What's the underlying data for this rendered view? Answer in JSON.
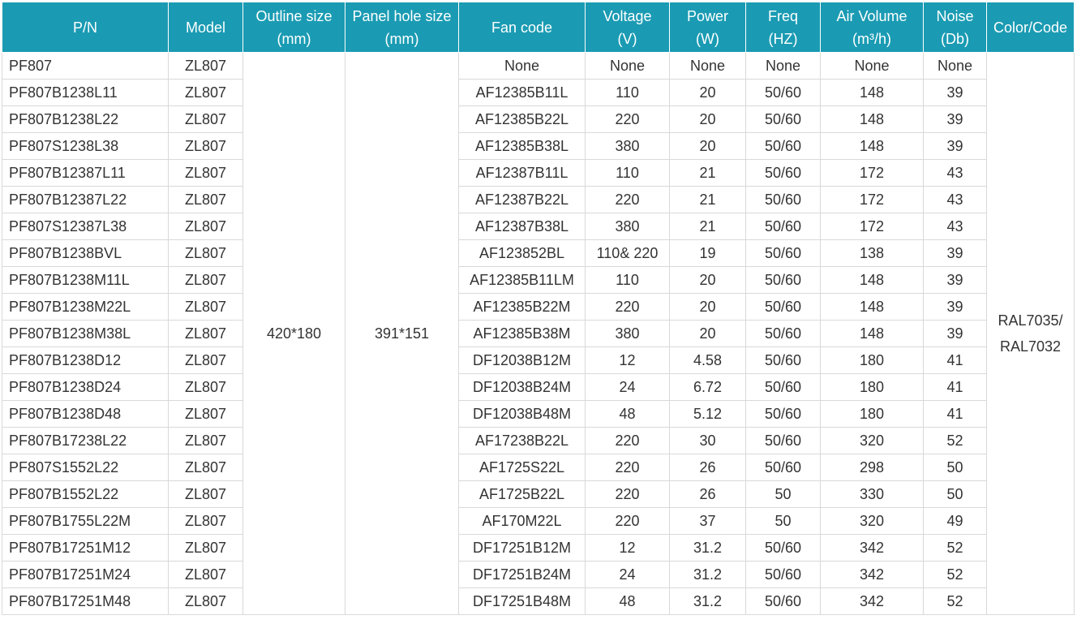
{
  "headers": [
    {
      "line1": "P/N",
      "line2": ""
    },
    {
      "line1": "Model",
      "line2": ""
    },
    {
      "line1": "Outline size",
      "line2": "(mm)"
    },
    {
      "line1": "Panel hole size",
      "line2": "(mm)"
    },
    {
      "line1": "Fan code",
      "line2": ""
    },
    {
      "line1": "Voltage",
      "line2": "(V)"
    },
    {
      "line1": "Power",
      "line2": "(W)"
    },
    {
      "line1": "Freq",
      "line2": "(HZ)"
    },
    {
      "line1": "Air Volume",
      "line2": "(m³/h)"
    },
    {
      "line1": "Noise",
      "line2": "(Db)"
    },
    {
      "line1": "Color/Code",
      "line2": ""
    }
  ],
  "merged": {
    "outline_size": "420*180",
    "panel_hole_size": "391*151",
    "color_code_line1": "RAL7035/",
    "color_code_line2": "RAL7032"
  },
  "rows": [
    {
      "pn": "PF807",
      "model": "ZL807",
      "fan_code": "None",
      "voltage": "None",
      "power": "None",
      "freq": "None",
      "air_volume": "None",
      "noise": "None"
    },
    {
      "pn": "PF807B1238L11",
      "model": "ZL807",
      "fan_code": "AF12385B11L",
      "voltage": "110",
      "power": "20",
      "freq": "50/60",
      "air_volume": "148",
      "noise": "39"
    },
    {
      "pn": "PF807B1238L22",
      "model": "ZL807",
      "fan_code": "AF12385B22L",
      "voltage": "220",
      "power": "20",
      "freq": "50/60",
      "air_volume": "148",
      "noise": "39"
    },
    {
      "pn": "PF807S1238L38",
      "model": "ZL807",
      "fan_code": "AF12385B38L",
      "voltage": "380",
      "power": "20",
      "freq": "50/60",
      "air_volume": "148",
      "noise": "39"
    },
    {
      "pn": "PF807B12387L11",
      "model": "ZL807",
      "fan_code": "AF12387B11L",
      "voltage": "110",
      "power": "21",
      "freq": "50/60",
      "air_volume": "172",
      "noise": "43"
    },
    {
      "pn": "PF807B12387L22",
      "model": "ZL807",
      "fan_code": "AF12387B22L",
      "voltage": "220",
      "power": "21",
      "freq": "50/60",
      "air_volume": "172",
      "noise": "43"
    },
    {
      "pn": "PF807S12387L38",
      "model": "ZL807",
      "fan_code": "AF12387B38L",
      "voltage": "380",
      "power": "21",
      "freq": "50/60",
      "air_volume": "172",
      "noise": "43"
    },
    {
      "pn": "PF807B1238BVL",
      "model": "ZL807",
      "fan_code": "AF123852BL",
      "voltage": "110& 220",
      "power": "19",
      "freq": "50/60",
      "air_volume": "138",
      "noise": "39"
    },
    {
      "pn": "PF807B1238M11L",
      "model": "ZL807",
      "fan_code": "AF12385B11LM",
      "voltage": "110",
      "power": "20",
      "freq": "50/60",
      "air_volume": "148",
      "noise": "39"
    },
    {
      "pn": "PF807B1238M22L",
      "model": "ZL807",
      "fan_code": "AF12385B22M",
      "voltage": "220",
      "power": "20",
      "freq": "50/60",
      "air_volume": "148",
      "noise": "39"
    },
    {
      "pn": "PF807B1238M38L",
      "model": "ZL807",
      "fan_code": "AF12385B38M",
      "voltage": "380",
      "power": "20",
      "freq": "50/60",
      "air_volume": "148",
      "noise": "39"
    },
    {
      "pn": "PF807B1238D12",
      "model": "ZL807",
      "fan_code": "DF12038B12M",
      "voltage": "12",
      "power": "4.58",
      "freq": "50/60",
      "air_volume": "180",
      "noise": "41"
    },
    {
      "pn": "PF807B1238D24",
      "model": "ZL807",
      "fan_code": "DF12038B24M",
      "voltage": "24",
      "power": "6.72",
      "freq": "50/60",
      "air_volume": "180",
      "noise": "41"
    },
    {
      "pn": "PF807B1238D48",
      "model": "ZL807",
      "fan_code": "DF12038B48M",
      "voltage": "48",
      "power": "5.12",
      "freq": "50/60",
      "air_volume": "180",
      "noise": "41"
    },
    {
      "pn": "PF807B17238L22",
      "model": "ZL807",
      "fan_code": "AF17238B22L",
      "voltage": "220",
      "power": "30",
      "freq": "50/60",
      "air_volume": "320",
      "noise": "52"
    },
    {
      "pn": "PF807S1552L22",
      "model": "ZL807",
      "fan_code": "AF1725S22L",
      "voltage": "220",
      "power": "26",
      "freq": "50/60",
      "air_volume": "298",
      "noise": "50"
    },
    {
      "pn": "PF807B1552L22",
      "model": "ZL807",
      "fan_code": "AF1725B22L",
      "voltage": "220",
      "power": "26",
      "freq": "50",
      "air_volume": "330",
      "noise": "50"
    },
    {
      "pn": "PF807B1755L22M",
      "model": "ZL807",
      "fan_code": "AF170M22L",
      "voltage": "220",
      "power": "37",
      "freq": "50",
      "air_volume": "320",
      "noise": "49"
    },
    {
      "pn": "PF807B17251M12",
      "model": "ZL807",
      "fan_code": "DF17251B12M",
      "voltage": "12",
      "power": "31.2",
      "freq": "50/60",
      "air_volume": "342",
      "noise": "52"
    },
    {
      "pn": "PF807B17251M24",
      "model": "ZL807",
      "fan_code": "DF17251B24M",
      "voltage": "24",
      "power": "31.2",
      "freq": "50/60",
      "air_volume": "342",
      "noise": "52"
    },
    {
      "pn": "PF807B17251M48",
      "model": "ZL807",
      "fan_code": "DF17251B48M",
      "voltage": "48",
      "power": "31.2",
      "freq": "50/60",
      "air_volume": "342",
      "noise": "52"
    }
  ],
  "colors": {
    "header_bg": "#1a9bb3",
    "header_text": "#ffffff",
    "cell_text": "#333333",
    "grid": "#d9d9d9"
  }
}
